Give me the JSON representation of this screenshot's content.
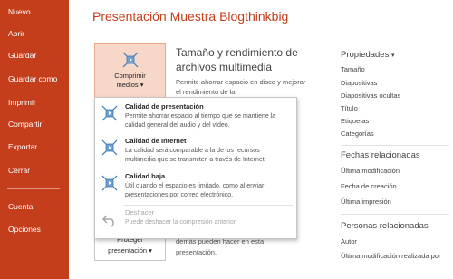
{
  "sidebar": {
    "items": [
      {
        "label": "Nuevo"
      },
      {
        "label": "Abrir"
      },
      {
        "label": "Guardar"
      },
      {
        "label": "Guardar como"
      },
      {
        "label": "Imprimir"
      },
      {
        "label": "Compartir"
      },
      {
        "label": "Exportar"
      },
      {
        "label": "Cerrar"
      },
      {
        "label": "Cuenta"
      },
      {
        "label": "Opciones"
      }
    ]
  },
  "page": {
    "title": "Presentación Muestra Blogthinkbig"
  },
  "compress": {
    "button_line1": "Comprimir",
    "button_line2": "medios",
    "button_chevron": "▾",
    "title": "Tamaño y rendimiento de archivos multimedia",
    "description": "Permite ahorrar espacio en disco y mejorar el rendimiento de la"
  },
  "dropdown": {
    "items": [
      {
        "title": "Calidad de presentación",
        "description": "Permite ahorrar espacio al tiempo que se mantiene la calidad general del audio y del vídeo."
      },
      {
        "title": "Calidad de Internet",
        "description": "La calidad será comparable a la de los recursos multimedia que se transmiten a través de Internet."
      },
      {
        "title": "Calidad baja",
        "description": "Útil cuando el espacio es limitado, como al enviar presentaciones por correo electrónico."
      },
      {
        "title": "Deshacer",
        "description": "Puede deshacer la compresión anterior."
      }
    ]
  },
  "background": {
    "protect_line1": "Proteger",
    "protect_line2": "presentación ▾",
    "text": "demás pueden hacer en esta presentación."
  },
  "properties": {
    "heading": "Propiedades",
    "heading_chevron": "▾",
    "items": [
      "Tamaño",
      "Diapositivas",
      "Diapositivas ocultas",
      "Título",
      "Etiquetas",
      "Categorías"
    ]
  },
  "dates": {
    "heading": "Fechas relacionadas",
    "items": [
      "Última modificación",
      "Fecha de creación",
      "Última impresión"
    ]
  },
  "people": {
    "heading": "Personas relacionadas",
    "items": [
      "Autor",
      "Última modificación realizada por"
    ]
  },
  "colors": {
    "accent": "#c43e1c",
    "button_fill": "#f7d7c8",
    "icon_blue": "#3a7ab8"
  },
  "icons": {
    "compress": "compress-media-icon",
    "quality": "compress-arrows-icon",
    "undo": "undo-icon"
  }
}
